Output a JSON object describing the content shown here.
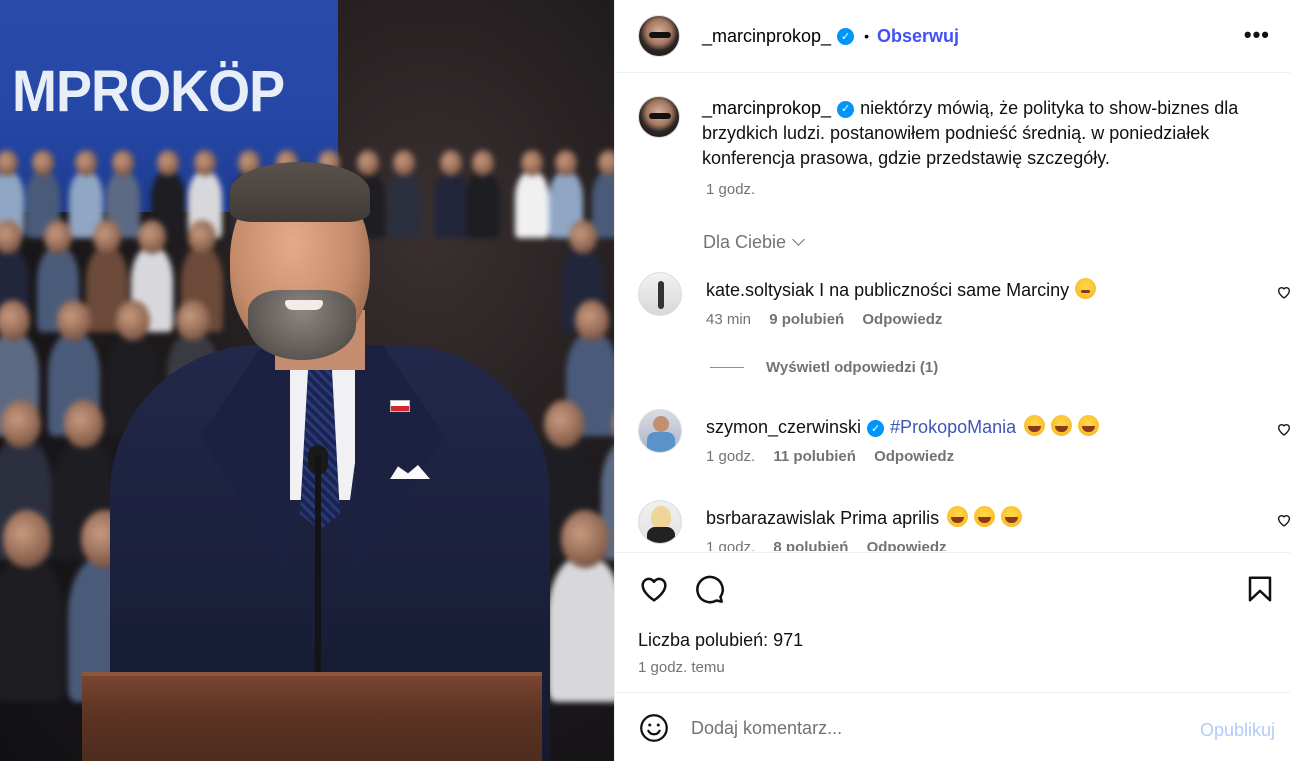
{
  "photo": {
    "banner_text": "MPROKÖP"
  },
  "header": {
    "username": "_marcinprokop_",
    "separator": "•",
    "follow_label": "Obserwuj",
    "more_icon": "more-horizontal-icon"
  },
  "caption": {
    "username": "_marcinprokop_",
    "text": "niektórzy mówią, że polityka to show-biznes dla brzydkich ludzi. postanowiłem podnieść średnią. w poniedziałek konferencja prasowa, gdzie przedstawię szczegóły.",
    "time": "1 godz."
  },
  "for_you_label": "Dla Ciebie",
  "comments": [
    {
      "username": "kate.soltysiak",
      "verified": false,
      "text": "I na publiczności same Marciny",
      "time": "43 min",
      "likes": "9 polubień",
      "reply_label": "Odpowiedz"
    },
    {
      "username": "szymon_czerwinski",
      "verified": true,
      "text": "#ProkopoMania",
      "time": "1 godz.",
      "likes": "11 polubień",
      "reply_label": "Odpowiedz"
    },
    {
      "username": "bsrbarazawislak",
      "verified": false,
      "text": "Prima aprilis",
      "time": "1 godz.",
      "likes": "8 polubień",
      "reply_label": "Odpowiedz"
    }
  ],
  "view_replies": "Wyświetl odpowiedzi (1)",
  "actions": {
    "likes_text": "Liczba polubień: 971",
    "post_time": "1 godz. temu"
  },
  "composer": {
    "placeholder": "Dodaj komentarz...",
    "publish_label": "Opublikuj"
  },
  "colors": {
    "follow_blue": "#4150f7",
    "verified_blue": "#0095f6",
    "hashtag_blue": "#3e55b8",
    "publish_disabled": "#b2cbfa",
    "secondary_text": "#737373"
  }
}
